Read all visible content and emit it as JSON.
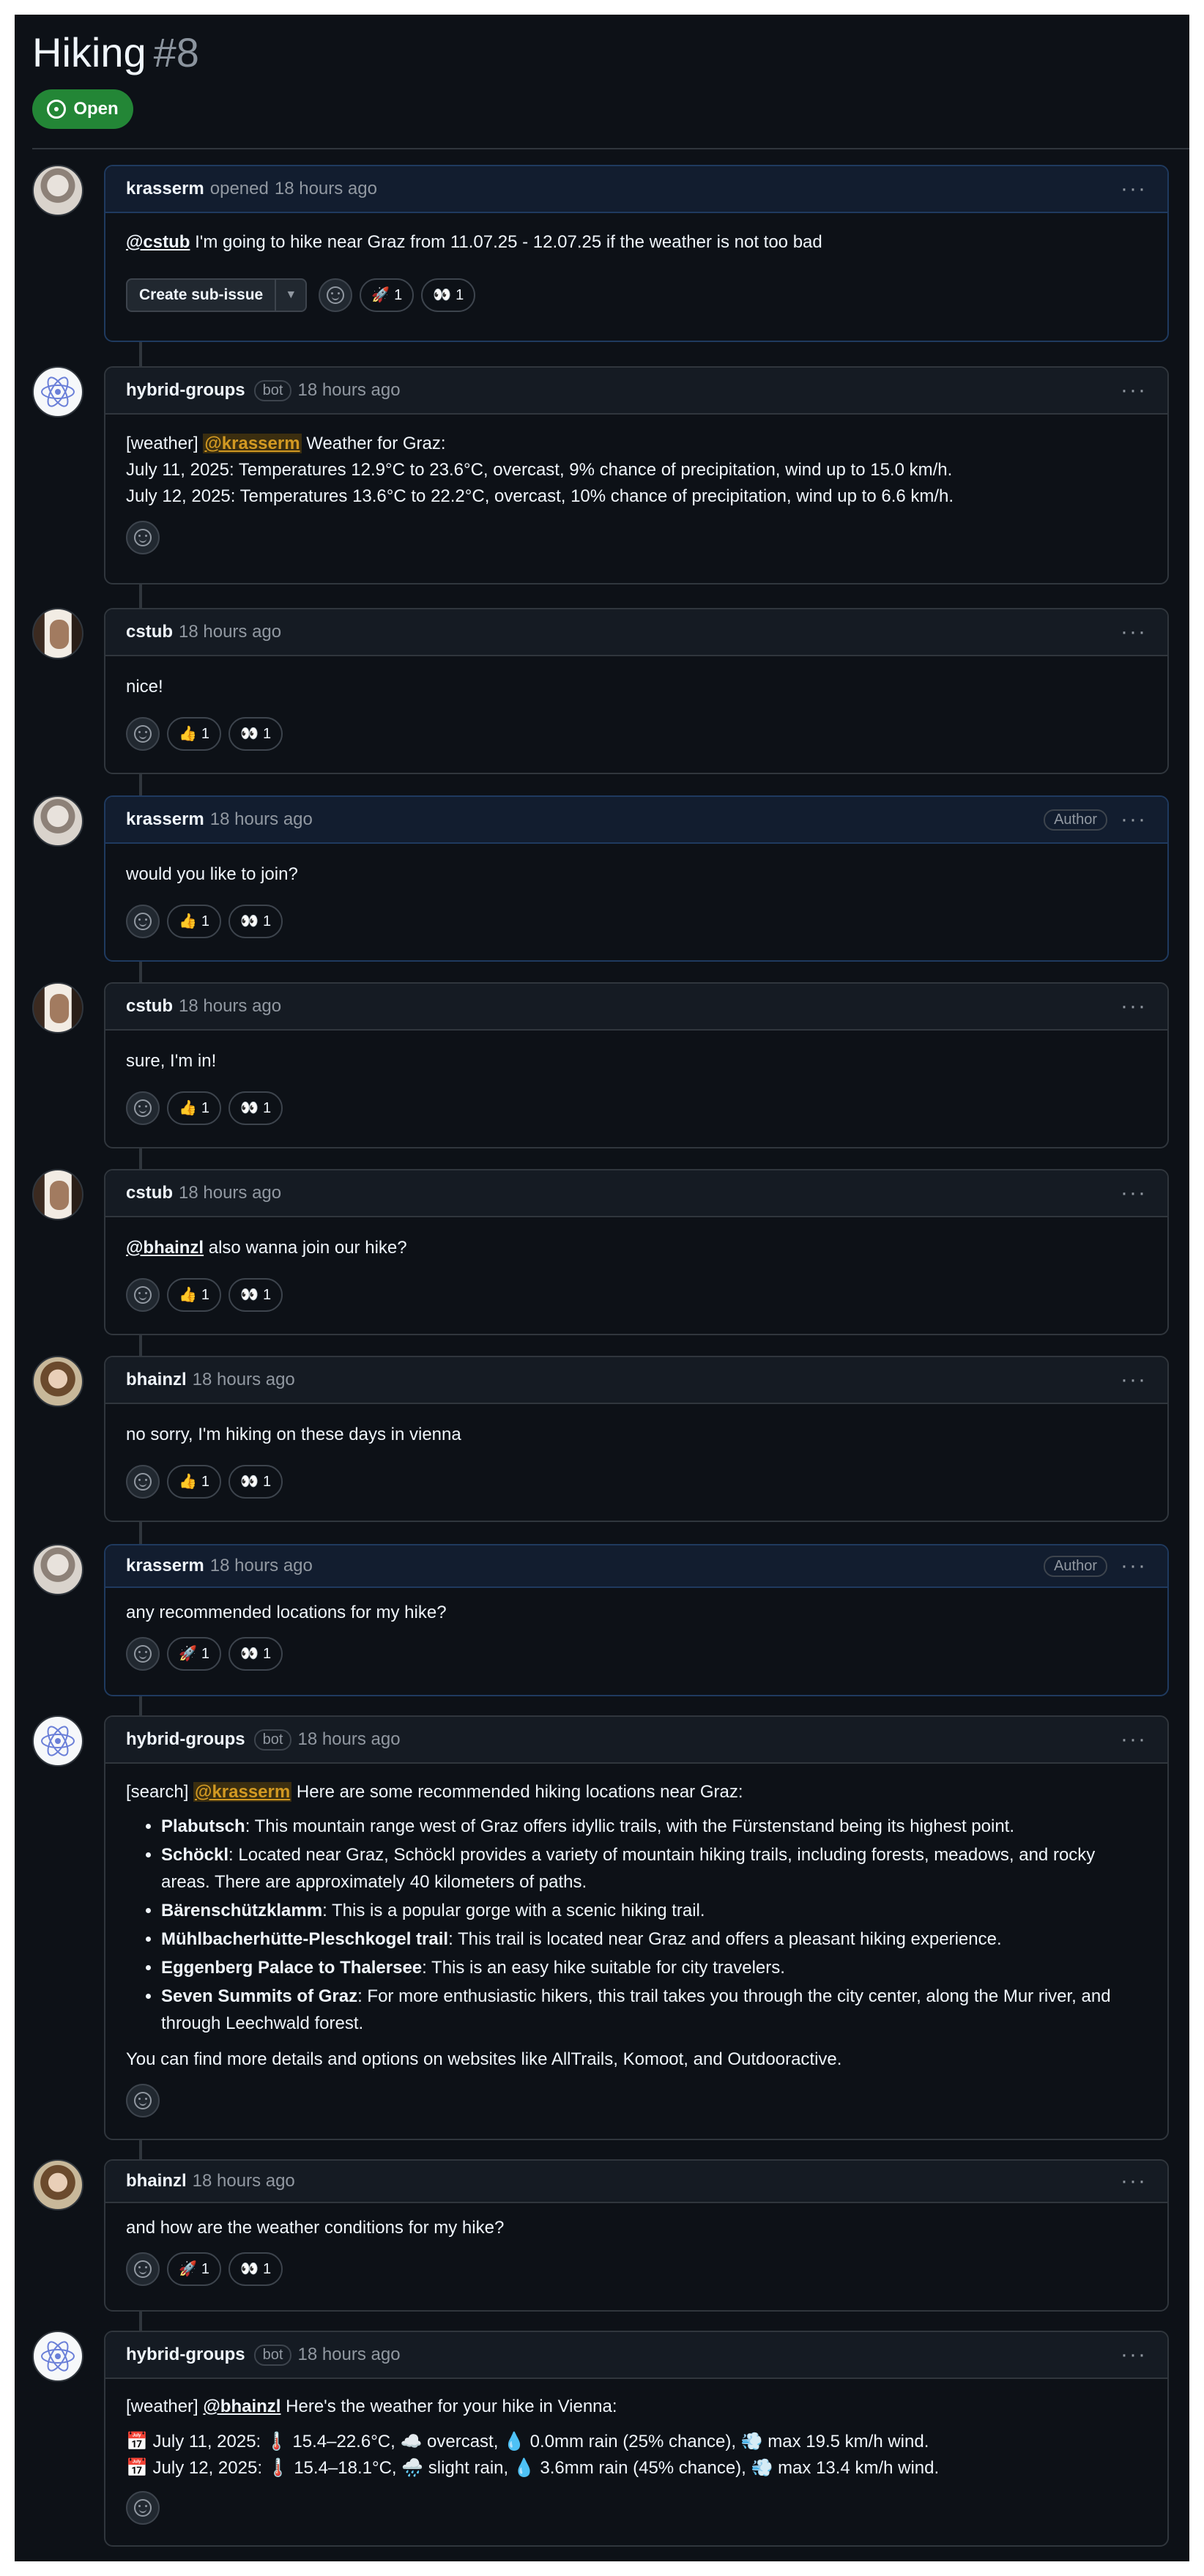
{
  "issue": {
    "title": "Hiking",
    "number": "#8",
    "state": "Open"
  },
  "comments": [
    {
      "author": "krasserm",
      "action": "opened",
      "time": "18 hours ago",
      "mention": "@cstub",
      "text": "I'm going to hike near Graz from 11.07.25 - 12.07.25 if the weather is not too bad",
      "create_subissue": "Create sub-issue",
      "reactions": [
        {
          "emoji": "🚀",
          "count": "1"
        },
        {
          "emoji": "👀",
          "count": "1"
        }
      ]
    },
    {
      "author": "hybrid-groups",
      "label": "bot",
      "time": "18 hours ago",
      "prefix": "[weather]",
      "mention": "@krasserm",
      "intro": "Weather for Graz:",
      "lines": [
        "July 11, 2025: Temperatures 12.9°C to 23.6°C, overcast, 9% chance of precipitation, wind up to 15.0 km/h.",
        "July 12, 2025: Temperatures 13.6°C to 22.2°C, overcast, 10% chance of precipitation, wind up to 6.6 km/h."
      ]
    },
    {
      "author": "cstub",
      "time": "18 hours ago",
      "text": "nice!",
      "reactions": [
        {
          "emoji": "👍",
          "count": "1"
        },
        {
          "emoji": "👀",
          "count": "1"
        }
      ]
    },
    {
      "author": "krasserm",
      "time": "18 hours ago",
      "badge": "Author",
      "text": "would you like to join?",
      "reactions": [
        {
          "emoji": "👍",
          "count": "1"
        },
        {
          "emoji": "👀",
          "count": "1"
        }
      ]
    },
    {
      "author": "cstub",
      "time": "18 hours ago",
      "text": "sure, I'm in!",
      "reactions": [
        {
          "emoji": "👍",
          "count": "1"
        },
        {
          "emoji": "👀",
          "count": "1"
        }
      ]
    },
    {
      "author": "cstub",
      "time": "18 hours ago",
      "mention": "@bhainzl",
      "text": "also wanna join our hike?",
      "reactions": [
        {
          "emoji": "👍",
          "count": "1"
        },
        {
          "emoji": "👀",
          "count": "1"
        }
      ]
    },
    {
      "author": "bhainzl",
      "time": "18 hours ago",
      "text": "no sorry, I'm hiking on these days in vienna",
      "reactions": [
        {
          "emoji": "👍",
          "count": "1"
        },
        {
          "emoji": "👀",
          "count": "1"
        }
      ]
    },
    {
      "author": "krasserm",
      "time": "18 hours ago",
      "badge": "Author",
      "text": "any recommended locations for my hike?",
      "reactions": [
        {
          "emoji": "🚀",
          "count": "1"
        },
        {
          "emoji": "👀",
          "count": "1"
        }
      ]
    },
    {
      "author": "hybrid-groups",
      "label": "bot",
      "time": "18 hours ago",
      "prefix": "[search]",
      "mention": "@krasserm",
      "intro": "Here are some recommended hiking locations near Graz:",
      "items": [
        {
          "name": "Plabutsch",
          "desc": ": This mountain range west of Graz offers idyllic trails, with the Fürstenstand being its highest point."
        },
        {
          "name": "Schöckl",
          "desc": ": Located near Graz, Schöckl provides a variety of mountain hiking trails, including forests, meadows, and rocky areas. There are approximately 40 kilometers of paths."
        },
        {
          "name": "Bärenschützklamm",
          "desc": ": This is a popular gorge with a scenic hiking trail."
        },
        {
          "name": "Mühlbacherhütte-Pleschkogel trail",
          "desc": ": This trail is located near Graz and offers a pleasant hiking experience."
        },
        {
          "name": "Eggenberg Palace to Thalersee",
          "desc": ": This is an easy hike suitable for city travelers."
        },
        {
          "name": "Seven Summits of Graz",
          "desc": ": For more enthusiastic hikers, this trail takes you through the city center, along the Mur river, and through Leechwald forest."
        }
      ],
      "outro": "You can find more details and options on websites like AllTrails, Komoot, and Outdooractive."
    },
    {
      "author": "bhainzl",
      "time": "18 hours ago",
      "text": "and how are the weather conditions for my hike?",
      "reactions": [
        {
          "emoji": "🚀",
          "count": "1"
        },
        {
          "emoji": "👀",
          "count": "1"
        }
      ]
    },
    {
      "author": "hybrid-groups",
      "label": "bot",
      "time": "18 hours ago",
      "prefix": "[weather]",
      "mention": "@bhainzl",
      "intro": "Here's the weather for your hike in Vienna:",
      "lines": [
        "📅 July 11, 2025: 🌡️ 15.4–22.6°C, ☁️ overcast, 💧 0.0mm rain (25% chance), 💨 max 19.5 km/h wind.",
        "📅 July 12, 2025: 🌡️ 15.4–18.1°C, 🌧️ slight rain, 💧 3.6mm rain (45% chance), 💨 max 13.4 km/h wind."
      ]
    }
  ]
}
